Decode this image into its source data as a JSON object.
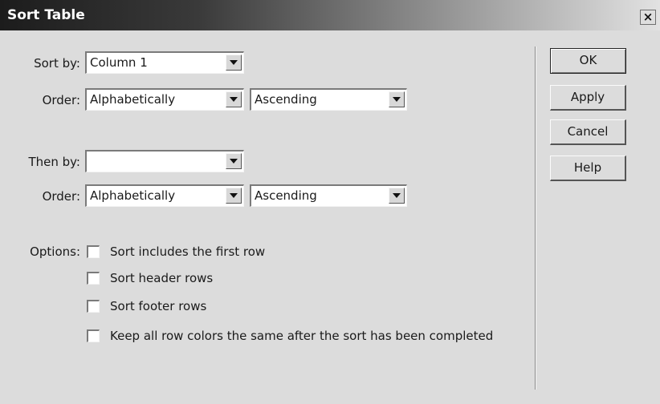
{
  "dialog": {
    "title": "Sort Table",
    "close_glyph": "×"
  },
  "sort_by": {
    "label": "Sort by:",
    "value": "Column 1",
    "order_label": "Order:",
    "order_type": "Alphabetically",
    "direction": "Ascending"
  },
  "then_by": {
    "label": "Then by:",
    "value": "",
    "order_label": "Order:",
    "order_type": "Alphabetically",
    "direction": "Ascending"
  },
  "options": {
    "label": "Options:",
    "items": [
      {
        "label": "Sort includes the first row",
        "checked": false
      },
      {
        "label": "Sort header rows",
        "checked": false
      },
      {
        "label": "Sort footer rows",
        "checked": false
      },
      {
        "label": "Keep all row colors the same after the sort has been completed",
        "checked": false
      }
    ]
  },
  "buttons": {
    "ok": "OK",
    "apply": "Apply",
    "cancel": "Cancel",
    "help": "Help"
  },
  "icons": {
    "dropdown": "chevron-down-icon",
    "close": "close-icon"
  }
}
